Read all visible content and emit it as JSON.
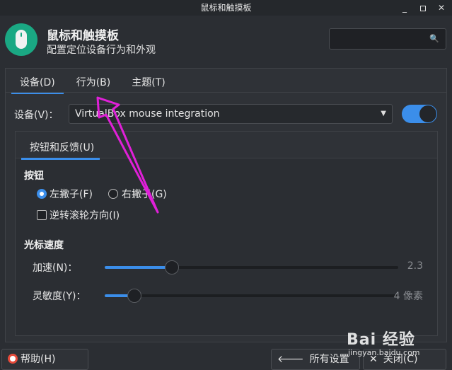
{
  "window": {
    "title": "鼠标和触摸板",
    "minimize_label": "_",
    "close_label": "✕"
  },
  "header": {
    "title": "鼠标和触摸板",
    "subtitle": "配置定位设备行为和外观",
    "search_placeholder": "",
    "search_icon": "magnifier-icon"
  },
  "tabs": [
    {
      "label": "设备(D)",
      "active": true
    },
    {
      "label": "行为(B)",
      "active": false
    },
    {
      "label": "主题(T)",
      "active": false
    }
  ],
  "device": {
    "label": "设备(V)：",
    "value": "VirtualBox mouse integration",
    "enabled": true
  },
  "inner_tab": {
    "label": "按钮和反馈(U)"
  },
  "buttons_section": {
    "title": "按钮",
    "left_handed": "左撇子(F)",
    "right_handed": "右撇子(G)",
    "reverse_scroll": "逆转滚轮方向(I)",
    "selected": "left"
  },
  "cursor_section": {
    "title": "光标速度",
    "acceleration_label": "加速(N)：",
    "acceleration_value": "2.3",
    "acceleration_fraction": 0.23,
    "sensitivity_label": "灵敏度(Y)：",
    "sensitivity_value": "4 像素",
    "sensitivity_fraction": 0.1
  },
  "footer": {
    "help": "帮助(H)",
    "all_settings": "所有设置(S)",
    "close": "关闭(C)"
  },
  "watermark": {
    "text": "Bai 经验",
    "url": "jingyan.baidu.com"
  },
  "colors": {
    "accent": "#3b8eea",
    "annotation_arrow": "#e020d8",
    "app_icon": "#1aa883"
  }
}
